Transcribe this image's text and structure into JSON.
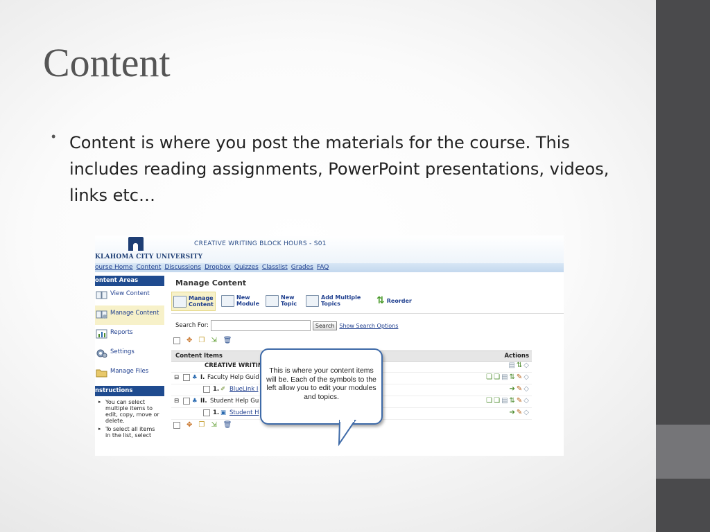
{
  "slide": {
    "title": "Content",
    "bullet": "Content is where you post the materials for the course.  This includes reading assignments, PowerPoint presentations, videos, links etc…"
  },
  "screenshot": {
    "course_title": "CREATIVE WRITING BLOCK HOURS - S01",
    "university": "KLAHOMA CITY UNIVERSITY",
    "nav": [
      "ourse Home",
      "Content",
      "Discussions",
      "Dropbox",
      "Quizzes",
      "Classlist",
      "Grades",
      "FAQ"
    ],
    "sidebar": {
      "content_areas_header": "ontent Areas",
      "items": [
        "View Content",
        "Manage Content",
        "Reports",
        "Settings",
        "Manage Files"
      ],
      "instructions_header": "nstructions",
      "instructions": [
        "You can select multiple items to edit, copy, move or delete.",
        "To select all items in the list, select"
      ]
    },
    "main": {
      "title": "Manage Content",
      "toolbar": {
        "manage_content": "Manage Content",
        "new_module": "New Module",
        "new_topic": "New Topic",
        "add_multiple_topics": "Add Multiple Topics",
        "reorder": "Reorder"
      },
      "search_label": "Search For:",
      "search_value": "",
      "search_button": "Search",
      "search_options_link": "Show Search Options",
      "table": {
        "col_items": "Content Items",
        "col_actions": "Actions",
        "rows": [
          {
            "prefix": "",
            "text": "CREATIVE WRITIN",
            "link": false
          },
          {
            "prefix": "I.",
            "text": "Faculty Help Guid",
            "link": false
          },
          {
            "prefix": "1.",
            "text": "BlueLink I",
            "link": true
          },
          {
            "prefix": "II.",
            "text": "Student Help Gu",
            "link": false
          },
          {
            "prefix": "1.",
            "text": "Student H",
            "link": true
          }
        ]
      }
    },
    "callout": "This is where your content items will be.  Each of the symbols to the left allow you to edit your modules and topics."
  },
  "colors": {
    "accent_blue": "#1f4b8f",
    "link_blue": "#1e3e8e",
    "rail_dark": "#4a4a4c",
    "rail_light": "#757578",
    "highlight": "#f7f1c9"
  }
}
